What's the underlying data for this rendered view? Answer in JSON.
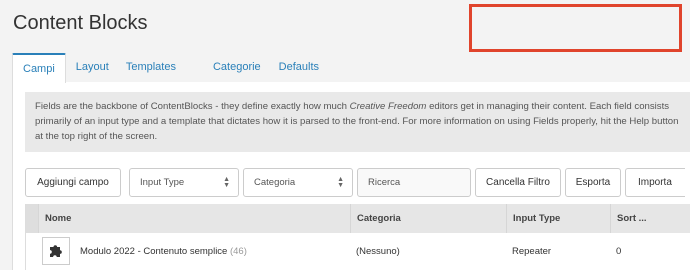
{
  "page": {
    "title": "Content Blocks"
  },
  "tabs": [
    {
      "label": "Campi",
      "active": true
    },
    {
      "label": "Layout",
      "active": false
    },
    {
      "label": "Templates",
      "active": false
    },
    {
      "label": "Categorie",
      "active": false
    },
    {
      "label": "Defaults",
      "active": false
    }
  ],
  "intro": {
    "text_before": "Fields are the backbone of ContentBlocks - they define exactly how much ",
    "emphasis": "Creative Freedom",
    "text_after": " editors get in managing their content. Each field consists primarily of an input type and a template that dictates how it is parsed to the front-end. For more information on using Fields properly, hit the Help button at the top right of the screen."
  },
  "toolbar": {
    "add_label": "Aggiungi campo",
    "input_type_value": "Input Type",
    "category_value": "Categoria",
    "search_placeholder": "Ricerca",
    "clear_filter_label": "Cancella Filtro",
    "export_label": "Esporta",
    "import_label": "Importa"
  },
  "table": {
    "columns": [
      "Nome",
      "Categoria",
      "Input Type",
      "Sort ..."
    ],
    "rows": [
      {
        "icon": "puzzle-icon",
        "name": "Modulo 2022 - Contenuto semplice",
        "id": "(46)",
        "category": "(Nessuno)",
        "input_type": "Repeater",
        "sort": "0"
      }
    ]
  },
  "colors": {
    "accent": "#2a80b9",
    "highlight_box": "#e0442c"
  }
}
